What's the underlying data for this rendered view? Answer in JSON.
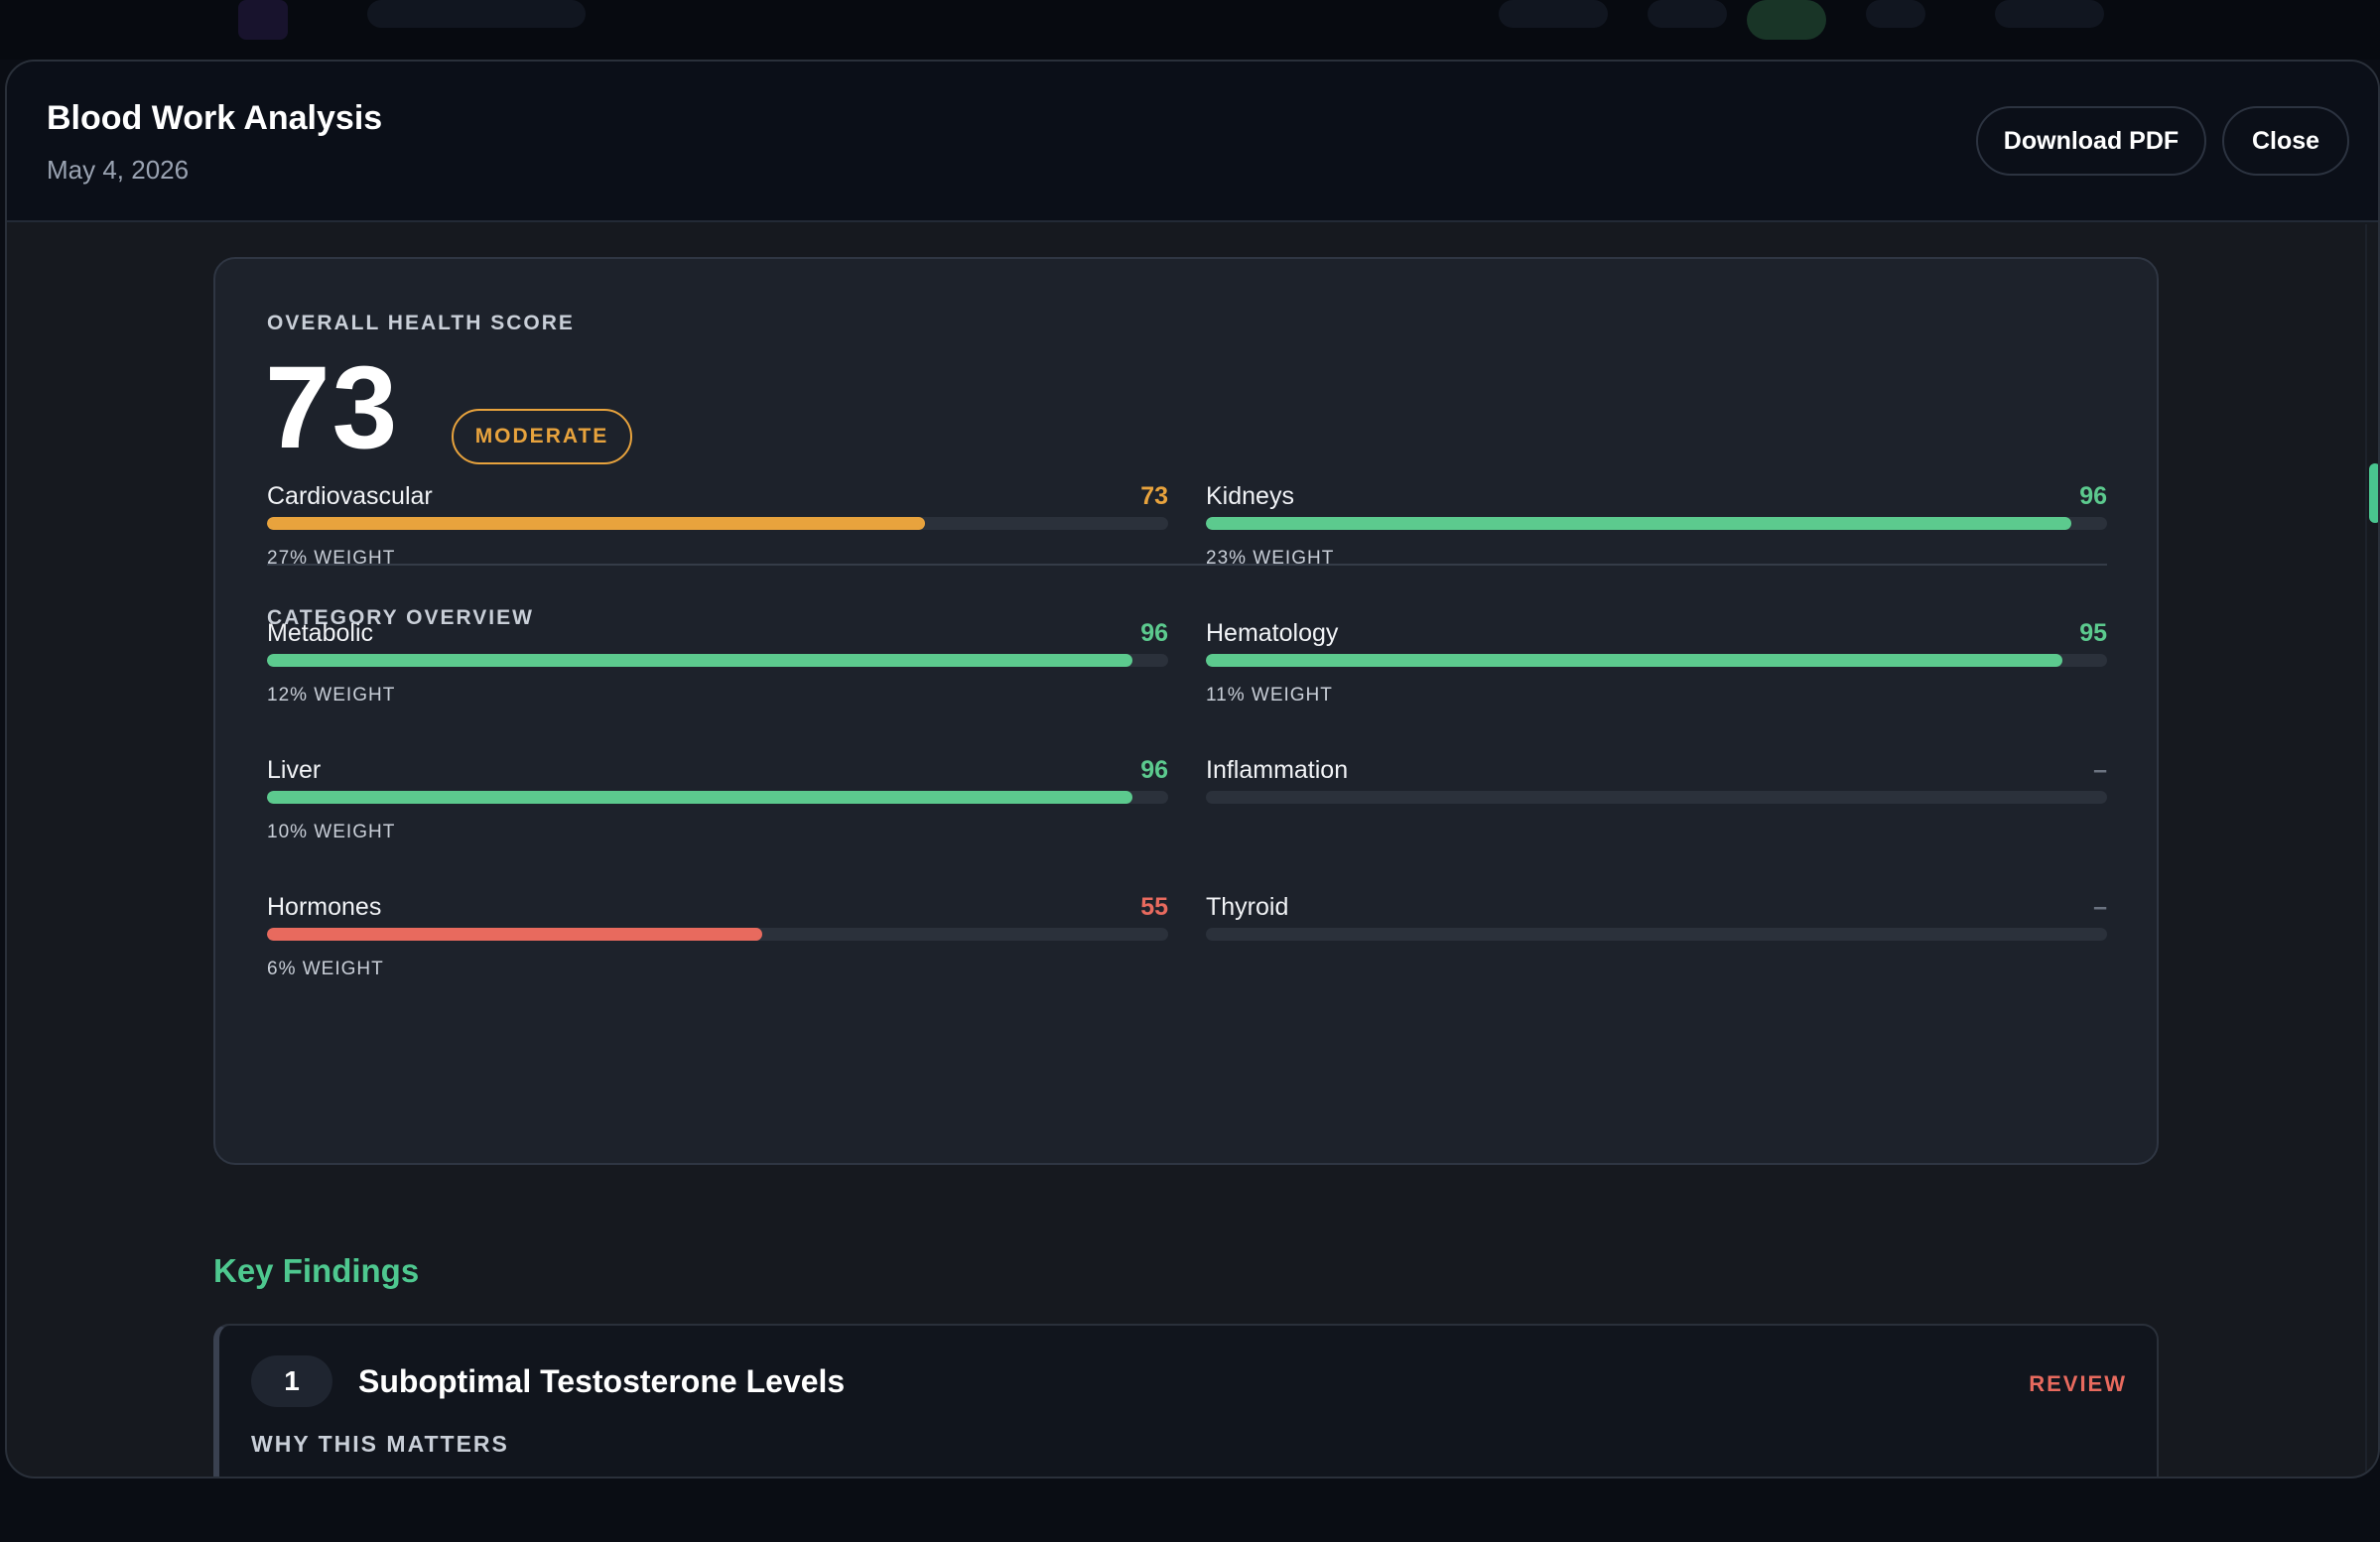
{
  "header": {
    "title": "Blood Work Analysis",
    "date": "May 4, 2026",
    "download_label": "Download PDF",
    "close_label": "Close"
  },
  "overall": {
    "label": "OVERALL HEALTH SCORE",
    "score": "73",
    "rating": "MODERATE",
    "rating_color": "#e8a33d"
  },
  "category_overview": {
    "label": "CATEGORY OVERVIEW",
    "items": [
      {
        "name": "Cardiovascular",
        "score": "73",
        "value": 73,
        "weight": "27% WEIGHT",
        "color": "#e8a33d"
      },
      {
        "name": "Kidneys",
        "score": "96",
        "value": 96,
        "weight": "23% WEIGHT",
        "color": "#5cca8e"
      },
      {
        "name": "Metabolic",
        "score": "96",
        "value": 96,
        "weight": "12% WEIGHT",
        "color": "#5cca8e"
      },
      {
        "name": "Hematology",
        "score": "95",
        "value": 95,
        "weight": "11% WEIGHT",
        "color": "#5cca8e"
      },
      {
        "name": "Liver",
        "score": "96",
        "value": 96,
        "weight": "10% WEIGHT",
        "color": "#5cca8e"
      },
      {
        "name": "Inflammation",
        "score": "–",
        "value": 0,
        "weight": "",
        "color": "#6b7380"
      },
      {
        "name": "Hormones",
        "score": "55",
        "value": 55,
        "weight": "6% WEIGHT",
        "color": "#e86a5e"
      },
      {
        "name": "Thyroid",
        "score": "–",
        "value": 0,
        "weight": "",
        "color": "#6b7380"
      }
    ]
  },
  "key_findings": {
    "heading": "Key Findings",
    "items": [
      {
        "number": "1",
        "title": "Suboptimal Testosterone Levels",
        "status": "REVIEW",
        "section_label": "WHY THIS MATTERS"
      }
    ]
  }
}
